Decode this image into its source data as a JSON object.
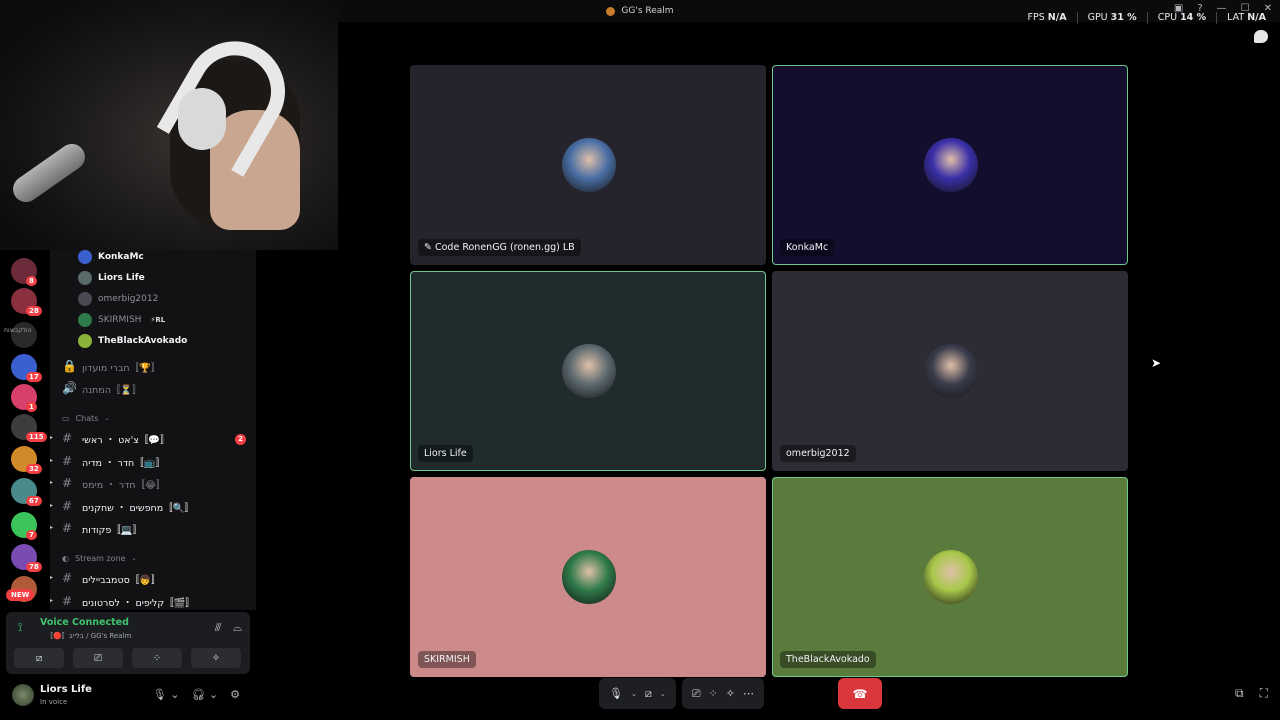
{
  "window": {
    "title": "GG's Realm"
  },
  "perf": [
    {
      "label": "FPS",
      "value": "N/A"
    },
    {
      "label": "GPU",
      "value": "31 %"
    },
    {
      "label": "CPU",
      "value": "14 %"
    },
    {
      "label": "LAT",
      "value": "N/A"
    }
  ],
  "servers": [
    {
      "badge": "8",
      "color": "#6b2b3a"
    },
    {
      "badge": "28",
      "color": "#8a2f3d"
    },
    {
      "label": "הולקבוצות",
      "color": "#2a2a2a"
    },
    {
      "badge": "17",
      "color": "#3a5fcf"
    },
    {
      "badge": "1",
      "color": "#d6406a"
    },
    {
      "badge": "115",
      "color": "#3d3d3d"
    },
    {
      "badge": "32",
      "color": "#d08a2a"
    },
    {
      "badge": "67",
      "color": "#4a8a8a"
    },
    {
      "badge": "7",
      "color": "#3bc45a"
    },
    {
      "badge": "78",
      "color": "#7a4bb0"
    },
    {
      "badge": "",
      "color": "#b05a3a"
    }
  ],
  "new_badge": "NEW",
  "voice_members": [
    {
      "name": "KonkaMc",
      "style": "bright",
      "avatar_color": "#3a5fcf"
    },
    {
      "name": "Liors Life",
      "style": "bright",
      "avatar_color": "#5a6a6a"
    },
    {
      "name": "omerbig2012",
      "style": "dim",
      "avatar_color": "#4a4a55"
    },
    {
      "name": "SKIRMISH",
      "style": "dim",
      "tag": "⚡RL",
      "avatar_color": "#2f7a4a"
    },
    {
      "name": "TheBlackAvokado",
      "style": "bright",
      "avatar_color": "#8ab33a"
    }
  ],
  "channels_top": [
    {
      "name": "〚🏆〛חברי מועדון",
      "icon": "🔒"
    },
    {
      "name": "〚⏳〛המתנה",
      "icon": "🔊"
    }
  ],
  "category_chats": "Chats",
  "channels_chats": [
    {
      "name": "〚💬〛צ'אט ・ ראשי",
      "style": "bright",
      "mention": "2"
    },
    {
      "name": "〚📺〛חדר ・ מדיה",
      "style": "bright"
    },
    {
      "name": "〚😂〛חדר ・ מימס",
      "style": "dim"
    },
    {
      "name": "〚🔍〛מחפשים ・ שחקנים",
      "style": "bright"
    },
    {
      "name": "〚💻〛פקודות",
      "style": "bright"
    }
  ],
  "category_stream": "Stream zone",
  "channels_stream": [
    {
      "name": "〚👦〛סטמבביילים",
      "style": "bright"
    },
    {
      "name": "〚🎬〛קליפים ・ לסרטונים",
      "style": "bright"
    }
  ],
  "voice": {
    "status": "Voice Connected",
    "sub": "〚🔴〛בלייב / GG's Realm"
  },
  "user": {
    "name": "Liors Life",
    "status": "In voice"
  },
  "tiles": [
    {
      "label": "Code RonenGG (ronen.gg) LB",
      "bg": "#25232b",
      "speaking": false,
      "avatar_color": "#4a6fa5",
      "prefix_icon": "✎ "
    },
    {
      "label": "KonkaMc",
      "bg": "#140e2e",
      "speaking": true,
      "avatar_color": "#3a2fa8",
      "prefix_icon": ""
    },
    {
      "label": "Liors Life",
      "bg": "#1f2b2d",
      "speaking": true,
      "avatar_color": "#5d6a70",
      "prefix_icon": ""
    },
    {
      "label": "omerbig2012",
      "bg": "#2d2b33",
      "speaking": false,
      "avatar_color": "#3a3c4c",
      "prefix_icon": ""
    },
    {
      "label": "SKIRMISH",
      "bg": "#cd8a8a",
      "speaking": false,
      "avatar_color": "#2f7a4a",
      "prefix_icon": ""
    },
    {
      "label": "TheBlackAvokado",
      "bg": "#5b7b3c",
      "speaking": true,
      "avatar_color": "#a8c84a",
      "prefix_icon": ""
    }
  ],
  "call_controls": [
    "mic",
    "camera-off",
    "screen-share",
    "activities",
    "soundboard",
    "more"
  ],
  "hangup_icon": "phone-hangup-icon"
}
